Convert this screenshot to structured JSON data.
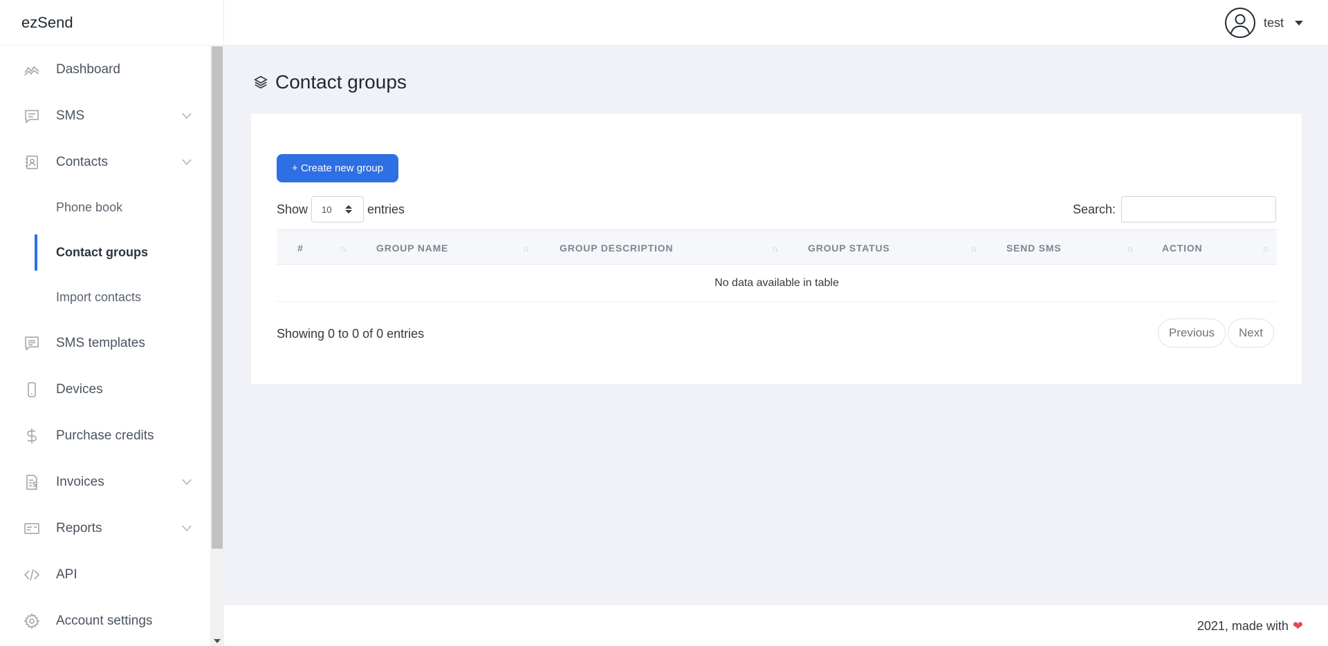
{
  "app": {
    "brand": "ezSend"
  },
  "user": {
    "name": "test"
  },
  "sidebar": {
    "items": [
      {
        "label": "Dashboard"
      },
      {
        "label": "SMS"
      },
      {
        "label": "Contacts"
      },
      {
        "label": "Phone book"
      },
      {
        "label": "Contact groups"
      },
      {
        "label": "Import contacts"
      },
      {
        "label": "SMS templates"
      },
      {
        "label": "Devices"
      },
      {
        "label": "Purchase credits"
      },
      {
        "label": "Invoices"
      },
      {
        "label": "Reports"
      },
      {
        "label": "API"
      },
      {
        "label": "Account settings"
      }
    ]
  },
  "page": {
    "title": "Contact groups"
  },
  "toolbar": {
    "create_label": "+ Create new group"
  },
  "table_controls": {
    "show_label": "Show",
    "page_size": "10",
    "entries_label": "entries",
    "search_label": "Search:"
  },
  "table": {
    "columns": [
      "#",
      "GROUP NAME",
      "GROUP DESCRIPTION",
      "GROUP STATUS",
      "SEND SMS",
      "ACTION"
    ],
    "empty_message": "No data available in table"
  },
  "pagination": {
    "info": "Showing 0 to 0 of 0 entries",
    "previous": "Previous",
    "next": "Next"
  },
  "footer": {
    "text": "2021, made with"
  }
}
